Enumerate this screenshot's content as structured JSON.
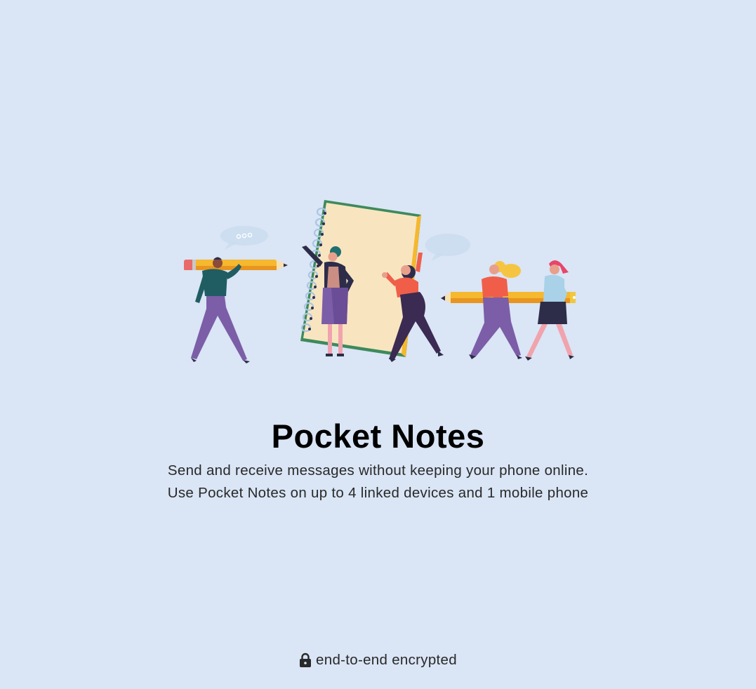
{
  "app": {
    "title": "Pocket Notes",
    "description_lines": [
      "Send and receive messages without keeping your phone online.",
      "Use Pocket Notes on up to 4 linked devices and 1 mobile phone"
    ]
  },
  "footer": {
    "encryption_label": "end-to-end encrypted",
    "icon": "lock-icon"
  },
  "illustration": {
    "icon": "people-with-pencils-and-notebook-illustration"
  },
  "colors": {
    "background": "#dae5f5",
    "title": "#000000",
    "text": "#292929",
    "pencil": "#f5b82e",
    "notebook": "#f8e5c0",
    "notebook_border": "#3d8a5c",
    "purple": "#7b5ea7",
    "coral": "#e85a47"
  }
}
